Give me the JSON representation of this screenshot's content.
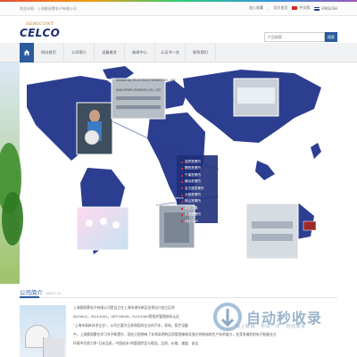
{
  "colors": {
    "brand": "#2b5a9e",
    "logo_gold": "#b87a1e",
    "logo_navy": "#1d2d75",
    "map_blue": "#2c3e8f",
    "red_marker": "#d52b1e"
  },
  "topbar": {
    "welcome": "欢迎光临 · 上海赛丽蒙电子有限公司",
    "links": [
      "加入收藏",
      "设为首页"
    ],
    "lang_cn": "中文版",
    "lang_en": "ENGLISH"
  },
  "header": {
    "logo_sub": "SEMICONT",
    "logo_main": "CELCO",
    "search_placeholder": "产品搜索",
    "search_button": "搜索"
  },
  "nav": {
    "home_icon": "home-icon",
    "items": [
      "网站首页",
      "公司简介",
      "设备概览",
      "新闻中心",
      "认证书一览",
      "联系我们"
    ]
  },
  "banner": {
    "caption_1": "SHANGHAI CELCO ELECTRONICS CO., LTD",
    "caption_2": "SHAI HYORI (SUZHOU) CO., LTD",
    "caption_3": "SHAI HYORI SHANGHAI BUSINESS OFFICE",
    "cities": [
      "滋賀営業所",
      "関西営業所",
      "千葉営業所",
      "横浜営業所",
      "名古屋営業所",
      "大阪営業所",
      "岡山営業所",
      "本社工場",
      "広島営業所",
      "(有) CAP"
    ]
  },
  "about": {
    "title": "公司简介",
    "subtitle": "ABOUT US",
    "lines": [
      "上海赛丽蒙电子有限公司是设立在上海市浦东新区金桥出口加工区的",
      "ISO9001，ISO14001，IATF16949，ISO13485等相关管理体系认证",
      "\"上海市高新技术企业\"，公司主要为日系和国内企业的汽车，家电，医疗设备",
      "中，上海赛丽蒙在学习并不断提升，现在已经拥有了非常高明的品质管理体制及强大的制造和生产技术能力，在竞争激烈的电子制造业大",
      "环境中仍然力争\"日本品质，中国成本\"的管理宗旨与理念，品质、价格、速度、安全"
    ]
  },
  "watermark": {
    "title": "自动秒收录",
    "tagline": "极上链接 · 秒访一次 · 自动收录"
  }
}
